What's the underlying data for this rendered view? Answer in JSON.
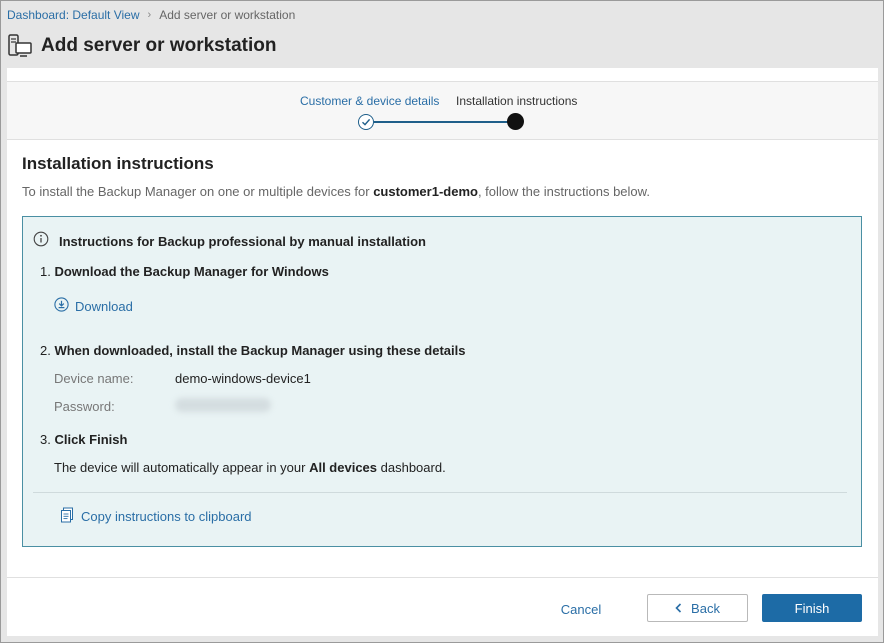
{
  "breadcrumb": {
    "parent": "Dashboard: Default View",
    "current": "Add server or workstation"
  },
  "header": {
    "title": "Add server or workstation",
    "icon": "server-workstation-icon"
  },
  "stepper": {
    "steps": [
      {
        "label": "Customer & device details",
        "state": "done"
      },
      {
        "label": "Installation instructions",
        "state": "active"
      }
    ]
  },
  "content": {
    "section_title": "Installation instructions",
    "intro_prefix": "To install the Backup Manager on one or multiple devices for ",
    "intro_customer": "customer1-demo",
    "intro_suffix": ", follow the instructions below."
  },
  "instructions": {
    "title": "Instructions for Backup professional by manual installation",
    "step1_num": "1.",
    "step1_label": "Download the Backup Manager for Windows",
    "download_label": "Download",
    "step2_num": "2.",
    "step2_label": "When downloaded, install the Backup Manager using these details",
    "device_name_label": "Device name:",
    "device_name_value": "demo-windows-device1",
    "password_label": "Password:",
    "step3_num": "3.",
    "step3_label": "Click Finish",
    "note_prefix": "The device will automatically appear in your ",
    "note_bold": "All devices",
    "note_suffix": " dashboard.",
    "copy_label": "Copy instructions to clipboard"
  },
  "footer": {
    "cancel_label": "Cancel",
    "back_label": "Back",
    "finish_label": "Finish"
  },
  "colors": {
    "accent": "#1d6ba6",
    "link": "#2a6ea6",
    "info_bg": "#e9f3f4",
    "info_border": "#4a8fa3"
  }
}
